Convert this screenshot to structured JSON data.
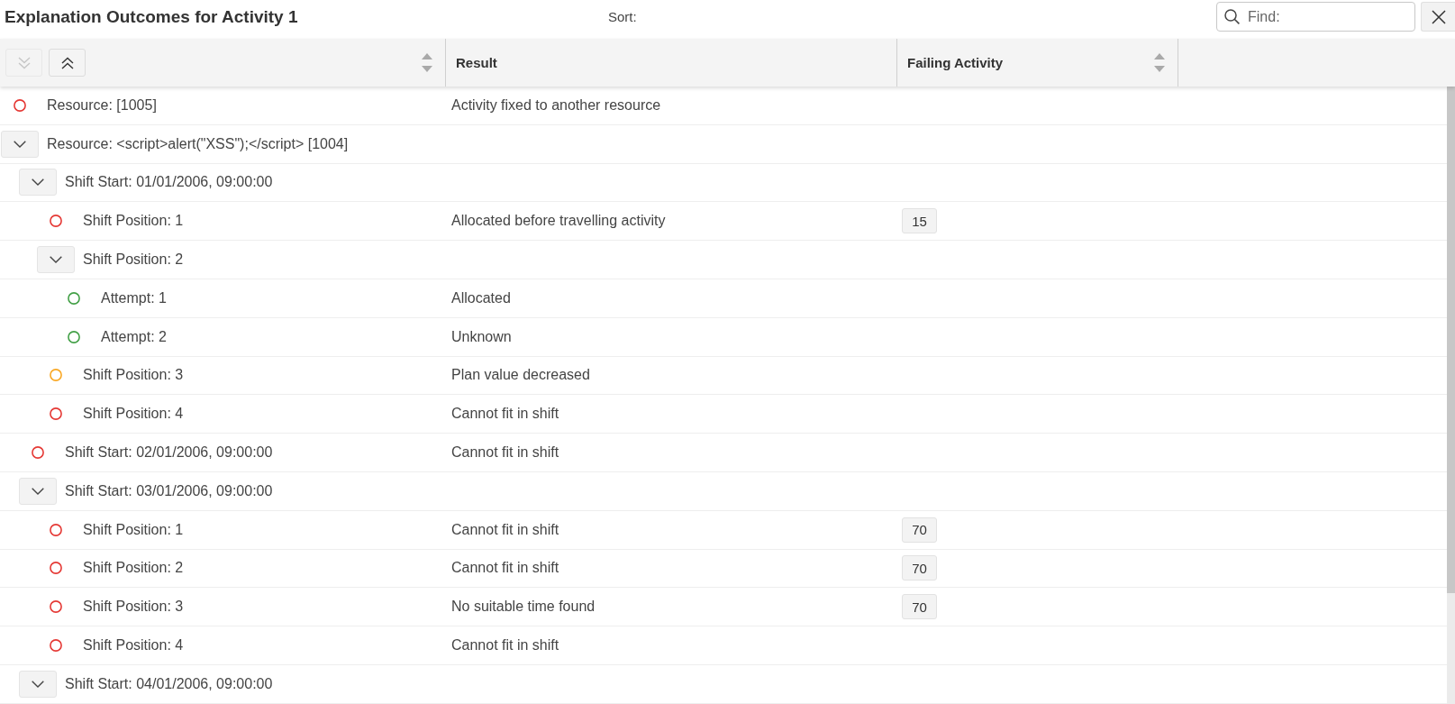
{
  "toolbar": {
    "title": "Explanation Outcomes for Activity 1",
    "sort_label": "Sort:",
    "find": {
      "placeholder": "Find:"
    }
  },
  "table": {
    "expand_all": {
      "disabled": true
    },
    "collapse_all": {
      "disabled": false
    },
    "columns": [
      {
        "sortable": true
      },
      {
        "label": "Result",
        "sortable": false
      },
      {
        "label": "Failing Activity",
        "sortable": true
      }
    ],
    "rows": [
      {
        "kind": "outcome",
        "label": "Resource: [1005]",
        "color": "#e53935",
        "result": "Activity fixed to another resource"
      },
      {
        "kind": "group",
        "label": "Resource: <script>alert(\"XSS\");</script> [1004]",
        "expanded": true,
        "children": [
          {
            "kind": "group",
            "label": "Shift Start: 01/01/2006, 09:00:00",
            "expanded": true,
            "children": [
              {
                "kind": "outcome",
                "label": "Shift Position: 1",
                "color": "#e53935",
                "result": "Allocated before travelling activity",
                "failing_activity": "15"
              },
              {
                "kind": "group",
                "label": "Shift Position: 2",
                "expanded": true,
                "children": [
                  {
                    "kind": "outcome",
                    "label": "Attempt: 1",
                    "color": "#43a047",
                    "result": "Allocated"
                  },
                  {
                    "kind": "outcome",
                    "label": "Attempt: 2",
                    "color": "#43a047",
                    "result": "Unknown"
                  }
                ]
              },
              {
                "kind": "outcome",
                "label": "Shift Position: 3",
                "color": "#f9a825",
                "result": "Plan value decreased"
              },
              {
                "kind": "outcome",
                "label": "Shift Position: 4",
                "color": "#e53935",
                "result": "Cannot fit in shift"
              }
            ]
          },
          {
            "kind": "outcome",
            "label": "Shift Start: 02/01/2006, 09:00:00",
            "color": "#e53935",
            "result": "Cannot fit in shift"
          },
          {
            "kind": "group",
            "label": "Shift Start: 03/01/2006, 09:00:00",
            "expanded": true,
            "children": [
              {
                "kind": "outcome",
                "label": "Shift Position: 1",
                "color": "#e53935",
                "result": "Cannot fit in shift",
                "failing_activity": "70"
              },
              {
                "kind": "outcome",
                "label": "Shift Position: 2",
                "color": "#e53935",
                "result": "Cannot fit in shift",
                "failing_activity": "70"
              },
              {
                "kind": "outcome",
                "label": "Shift Position: 3",
                "color": "#e53935",
                "result": "No suitable time found",
                "failing_activity": "70"
              },
              {
                "kind": "outcome",
                "label": "Shift Position: 4",
                "color": "#e53935",
                "result": "Cannot fit in shift"
              }
            ]
          },
          {
            "kind": "group",
            "label": "Shift Start: 04/01/2006, 09:00:00",
            "expanded": true
          }
        ]
      }
    ]
  }
}
